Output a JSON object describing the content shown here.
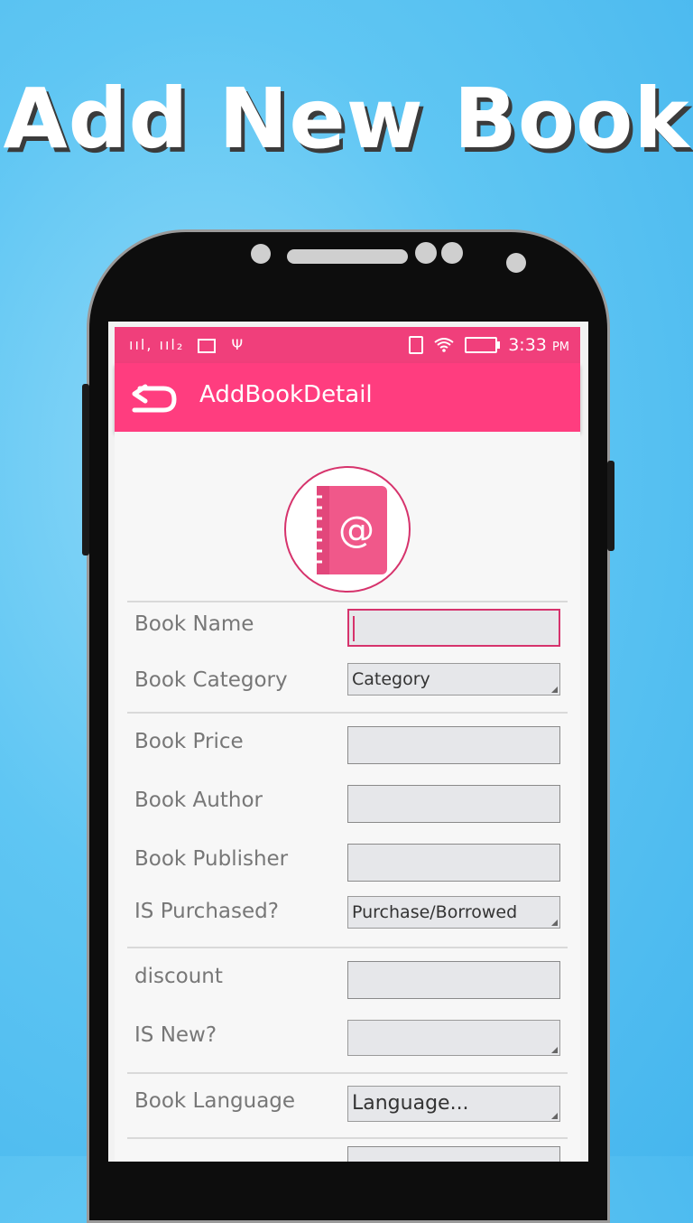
{
  "promo": {
    "title": "Add New Book"
  },
  "status_bar": {
    "signal_icons": "ııl, ııl₂",
    "time": "3:33",
    "ampm": "PM"
  },
  "appbar": {
    "title": "AddBookDetail"
  },
  "form": {
    "book_name_label": "Book Name",
    "book_category_label": "Book Category",
    "category_value": "Category",
    "book_price_label": "Book Price",
    "book_author_label": "Book Author",
    "book_publisher_label": "Book Publisher",
    "is_purchased_label": "IS Purchased?",
    "purchase_value": "Purchase/Borrowed",
    "discount_label": "discount",
    "is_new_label": "IS New?",
    "book_language_label": "Book Language",
    "language_value": "Language..."
  },
  "colors": {
    "accent": "#ff3d7f",
    "status_bar": "#f03f7b",
    "focus": "#d6336c",
    "background": "#5fc6f3"
  },
  "icons": [
    "back-icon",
    "notebook-at-icon",
    "wifi-icon",
    "battery-icon",
    "usb-icon",
    "gallery-icon",
    "vibrate-icon"
  ]
}
